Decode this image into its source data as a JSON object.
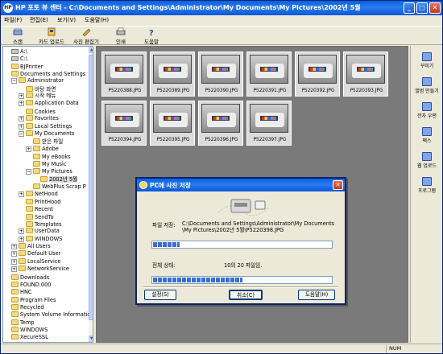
{
  "window": {
    "app_icon_text": "HP",
    "title": "HP 포토 뷰 센터 - C:\\Documents and Settings\\Administrator\\My Documents\\My Pictures\\2002년 5월",
    "minimize_glyph": "_",
    "maximize_glyph": "□",
    "close_glyph": "✕"
  },
  "menu": [
    "파일(F)",
    "편집(E)",
    "보기(V)",
    "도움말(H)"
  ],
  "toolbar": [
    {
      "label": "스캔",
      "icon": "scanner-icon"
    },
    {
      "label": "카드 업로드",
      "icon": "card-upload-icon"
    },
    {
      "label": "사진 편집기",
      "icon": "photo-editor-icon"
    },
    {
      "label": "인쇄",
      "icon": "printer-icon"
    },
    {
      "label": "도움말",
      "icon": "help-icon"
    }
  ],
  "tree": [
    {
      "label": "A:\\",
      "level": 0,
      "kind": "drive",
      "exp": ""
    },
    {
      "label": "C:\\",
      "level": 0,
      "kind": "drive",
      "exp": ""
    },
    {
      "label": "BJPrinter",
      "level": 0,
      "kind": "folder",
      "exp": ""
    },
    {
      "label": "Documents and Settings",
      "level": 0,
      "kind": "folder",
      "exp": ""
    },
    {
      "label": "Administrator",
      "level": 1,
      "kind": "folder",
      "exp": "−"
    },
    {
      "label": "바탕 화면",
      "level": 2,
      "kind": "folder",
      "exp": ""
    },
    {
      "label": "시작 메뉴",
      "level": 2,
      "kind": "folder",
      "exp": "+"
    },
    {
      "label": "Application Data",
      "level": 2,
      "kind": "folder",
      "exp": "+"
    },
    {
      "label": "Cookies",
      "level": 2,
      "kind": "folder",
      "exp": ""
    },
    {
      "label": "Favorites",
      "level": 2,
      "kind": "folder",
      "exp": "+"
    },
    {
      "label": "Local Settings",
      "level": 2,
      "kind": "folder",
      "exp": "+"
    },
    {
      "label": "My Documents",
      "level": 2,
      "kind": "folder",
      "exp": "−"
    },
    {
      "label": "받은 파일",
      "level": 3,
      "kind": "folder",
      "exp": ""
    },
    {
      "label": "Adobe",
      "level": 3,
      "kind": "folder",
      "exp": "+"
    },
    {
      "label": "My eBooks",
      "level": 3,
      "kind": "folder",
      "exp": ""
    },
    {
      "label": "My Music",
      "level": 3,
      "kind": "folder",
      "exp": ""
    },
    {
      "label": "My Pictures",
      "level": 3,
      "kind": "folder",
      "exp": "−"
    },
    {
      "label": "2002년 5월",
      "level": 4,
      "kind": "folder",
      "exp": "",
      "selected": true
    },
    {
      "label": "WebPlus Scrap P",
      "level": 3,
      "kind": "folder",
      "exp": ""
    },
    {
      "label": "NetHood",
      "level": 2,
      "kind": "folder",
      "exp": "+"
    },
    {
      "label": "PrintHood",
      "level": 2,
      "kind": "folder",
      "exp": ""
    },
    {
      "label": "Recent",
      "level": 2,
      "kind": "folder",
      "exp": ""
    },
    {
      "label": "SendTo",
      "level": 2,
      "kind": "folder",
      "exp": ""
    },
    {
      "label": "Templates",
      "level": 2,
      "kind": "folder",
      "exp": ""
    },
    {
      "label": "UserData",
      "level": 2,
      "kind": "folder",
      "exp": "+"
    },
    {
      "label": "WINDOWS",
      "level": 2,
      "kind": "folder",
      "exp": "+"
    },
    {
      "label": "All Users",
      "level": 1,
      "kind": "folder",
      "exp": "+"
    },
    {
      "label": "Default User",
      "level": 1,
      "kind": "folder",
      "exp": "+"
    },
    {
      "label": "LocalService",
      "level": 1,
      "kind": "folder",
      "exp": "+"
    },
    {
      "label": "NetworkService",
      "level": 1,
      "kind": "folder",
      "exp": "+"
    },
    {
      "label": "Downloads",
      "level": 0,
      "kind": "folder",
      "exp": ""
    },
    {
      "label": "FOUND.000",
      "level": 0,
      "kind": "folder",
      "exp": ""
    },
    {
      "label": "HNC",
      "level": 0,
      "kind": "folder",
      "exp": ""
    },
    {
      "label": "Program Files",
      "level": 0,
      "kind": "folder",
      "exp": ""
    },
    {
      "label": "Recycled",
      "level": 0,
      "kind": "folder",
      "exp": ""
    },
    {
      "label": "System Volume Information",
      "level": 0,
      "kind": "folder",
      "exp": ""
    },
    {
      "label": "Temp",
      "level": 0,
      "kind": "folder",
      "exp": ""
    },
    {
      "label": "WINDOWS",
      "level": 0,
      "kind": "folder",
      "exp": ""
    },
    {
      "label": "XecureSSL",
      "level": 0,
      "kind": "folder",
      "exp": ""
    }
  ],
  "thumbnails": [
    "P5220388.JPG",
    "P5220389.JPG",
    "P5220390.JPG",
    "P5220391.JPG",
    "P5220392.JPG",
    "P5220393.JPG",
    "P5220394.JPG",
    "P5220395.JPG",
    "P5220396.JPG",
    "P5220397.JPG"
  ],
  "right_panel": [
    {
      "label": "꾸미기",
      "icon": "decorate-icon"
    },
    {
      "label": "앨범 만들기",
      "icon": "album-icon"
    },
    {
      "label": "전자 우편",
      "icon": "email-icon"
    },
    {
      "label": "팩스",
      "icon": "fax-icon"
    },
    {
      "label": "웹 업로드",
      "icon": "web-upload-icon"
    },
    {
      "label": "프로그램",
      "icon": "program-icon"
    }
  ],
  "status": {
    "num": "NUM"
  },
  "dialog": {
    "title": "PC에 사진 저장",
    "close_glyph": "✕",
    "file_save_label": "파일 저장:",
    "file_path": "C:\\Documents and Settings\\Administrator\\My Documents\\My Pictures\\2002년 5월\\P5220398.JPG",
    "file_progress": 0.15,
    "overall_label": "전체 상태:",
    "overall_text": "10의 20 파일임.",
    "overall_progress": 0.5,
    "buttons": {
      "settings": "설정(S)",
      "cancel": "취소(C)",
      "help": "도움말(H)"
    }
  }
}
